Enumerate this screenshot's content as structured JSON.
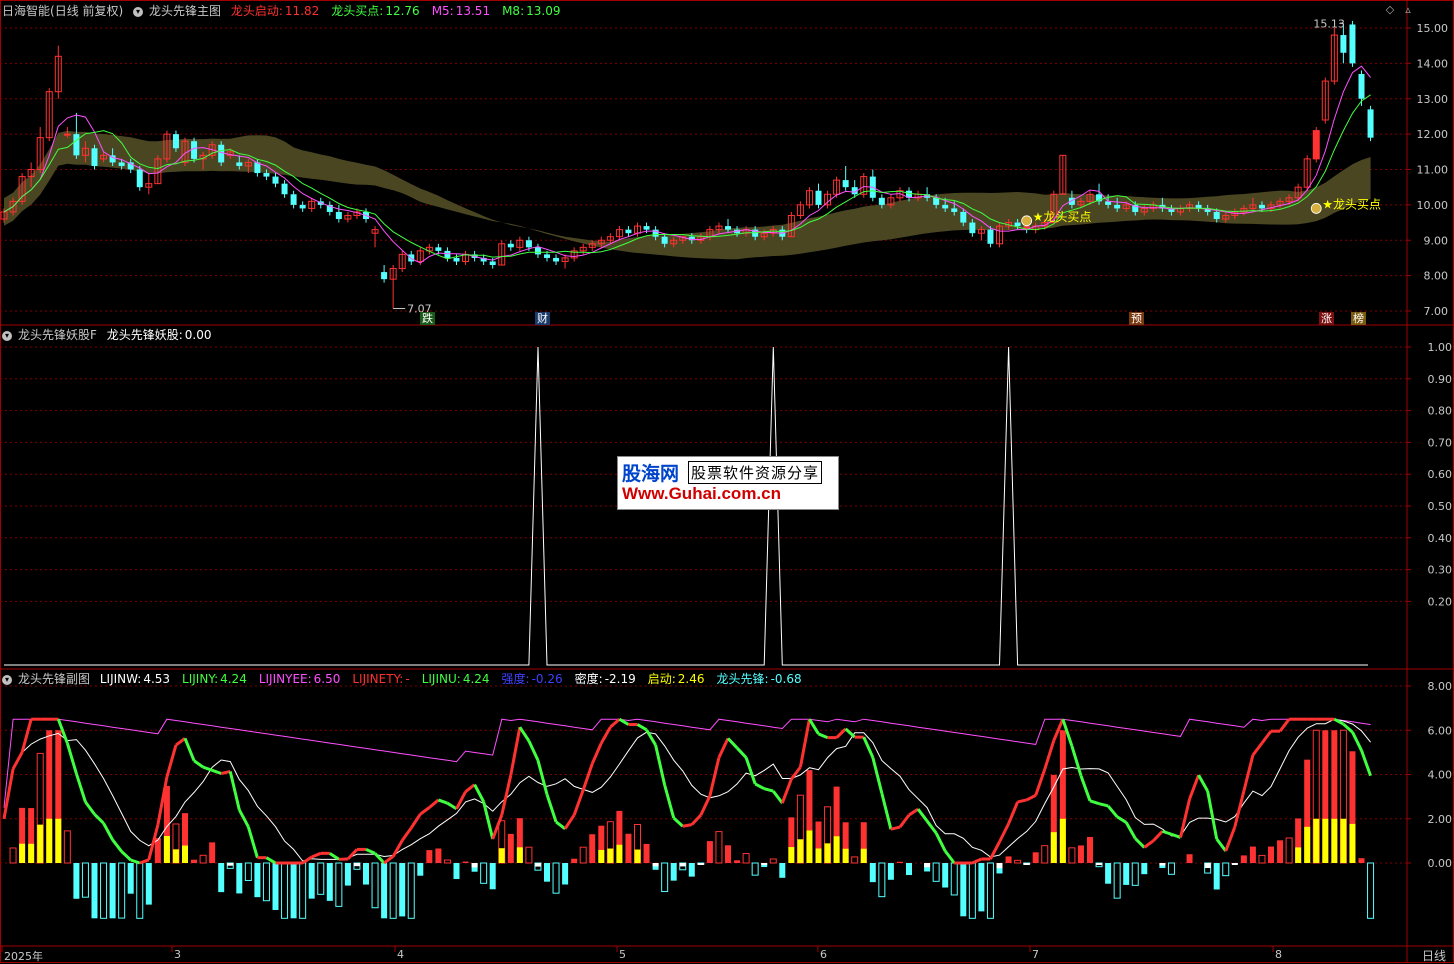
{
  "colors": {
    "up": "#ff3232",
    "down": "#54ffff",
    "ma5": "#ff50ff",
    "ma8": "#40ff40",
    "band": "#4a4622",
    "grid": "#800000",
    "border": "#a00000",
    "yellow": "#ffff00"
  },
  "main_panel": {
    "app_name": "日海智能",
    "period": "(日线 前复权)",
    "indicator_name": "龙头先锋主图",
    "legend": [
      {
        "label": "龙头启动:",
        "value": "11.82",
        "color": "#ff3030"
      },
      {
        "label": "龙头买点:",
        "value": "12.76",
        "color": "#40ff40"
      },
      {
        "label": "M5:",
        "value": "13.51",
        "color": "#ff50ff"
      },
      {
        "label": "M8:",
        "value": "13.09",
        "color": "#40ff40"
      }
    ],
    "y_ticks": [
      "15.00",
      "14.00",
      "13.00",
      "12.00",
      "11.00",
      "10.00",
      "9.00",
      "8.00",
      "7.00"
    ],
    "high_label": "15.13",
    "low_label": "7.07",
    "buy_point_label": "★龙头买点",
    "markers": [
      {
        "text": "跌",
        "bg": "#1a5a1a",
        "color": "#ffffff"
      },
      {
        "text": "财",
        "bg": "#1a3a6a",
        "color": "#ffffff"
      },
      {
        "text": "预",
        "bg": "#7a3a10",
        "color": "#ffffff"
      },
      {
        "text": "涨",
        "bg": "#7a1010",
        "color": "#ffffff"
      },
      {
        "text": "榜",
        "bg": "#7a5a10",
        "color": "#ffffff"
      }
    ]
  },
  "mid_panel": {
    "indicator_name": "龙头先锋妖股F",
    "legend": [
      {
        "label": "龙头先锋妖股:",
        "value": "0.00",
        "color": "#ffffff"
      }
    ],
    "y_ticks": [
      "1.00",
      "0.90",
      "0.80",
      "0.70",
      "0.60",
      "0.50",
      "0.40",
      "0.30",
      "0.20"
    ]
  },
  "bottom_panel": {
    "indicator_name": "龙头先锋副图",
    "legend": [
      {
        "label": "LIJINW:",
        "value": "4.53",
        "color": "#ffffff"
      },
      {
        "label": "LIJINY:",
        "value": "4.24",
        "color": "#40ff40"
      },
      {
        "label": "LIJINYEE:",
        "value": "6.50",
        "color": "#ff50ff"
      },
      {
        "label": "LIJINETY:",
        "value": "-",
        "color": "#ff3030"
      },
      {
        "label": "LIJINU:",
        "value": "4.24",
        "color": "#40ff40"
      },
      {
        "label": "强度:",
        "value": "-0.26",
        "color": "#4040ff"
      },
      {
        "label": "密度:",
        "value": "-2.19",
        "color": "#ffffff"
      },
      {
        "label": "启动:",
        "value": "2.46",
        "color": "#ffff00"
      },
      {
        "label": "龙头先锋:",
        "value": "-0.68",
        "color": "#54ffff"
      }
    ],
    "y_ticks": [
      "8.00",
      "6.00",
      "4.00",
      "2.00",
      "0.00"
    ]
  },
  "time_axis": {
    "labels": [
      "2025年",
      "3",
      "4",
      "5",
      "6",
      "7",
      "8"
    ],
    "period_button": "日线"
  },
  "watermark": {
    "logo": "股海网",
    "slogan": "股票软件资源分享",
    "url": "Www.Guhai.com.cn"
  },
  "chart_data": [
    {
      "type": "candlestick",
      "title": "龙头先锋主图",
      "ylim": [
        6.7,
        15.4
      ],
      "candles": [
        [
          9.6,
          9.9,
          9.5,
          9.8
        ],
        [
          9.8,
          10.2,
          9.7,
          10.1
        ],
        [
          10.1,
          10.9,
          10.0,
          10.8
        ],
        [
          10.8,
          11.2,
          10.5,
          11.0
        ],
        [
          11.0,
          12.2,
          10.9,
          11.9
        ],
        [
          11.9,
          13.3,
          11.8,
          13.2
        ],
        [
          13.2,
          14.5,
          13.0,
          14.2
        ],
        [
          12.0,
          12.2,
          11.9,
          12.0
        ],
        [
          12.0,
          12.6,
          11.3,
          11.4
        ],
        [
          11.4,
          11.8,
          11.2,
          11.6
        ],
        [
          11.6,
          11.7,
          11.0,
          11.1
        ],
        [
          11.3,
          11.5,
          11.2,
          11.4
        ],
        [
          11.4,
          11.6,
          11.1,
          11.2
        ],
        [
          11.2,
          11.3,
          11.0,
          11.1
        ],
        [
          11.2,
          11.3,
          10.9,
          11.0
        ],
        [
          11.0,
          11.1,
          10.4,
          10.5
        ],
        [
          10.5,
          10.9,
          10.3,
          10.6
        ],
        [
          10.6,
          11.4,
          10.6,
          11.3
        ],
        [
          11.3,
          12.1,
          11.2,
          12.0
        ],
        [
          12.0,
          12.1,
          11.5,
          11.6
        ],
        [
          11.2,
          11.9,
          11.1,
          11.8
        ],
        [
          11.8,
          11.9,
          11.2,
          11.3
        ],
        [
          11.3,
          11.5,
          11.0,
          11.4
        ],
        [
          11.4,
          11.8,
          11.3,
          11.7
        ],
        [
          11.7,
          11.8,
          11.1,
          11.2
        ],
        [
          11.4,
          11.6,
          11.3,
          11.5
        ],
        [
          11.2,
          11.4,
          11.0,
          11.1
        ],
        [
          11.1,
          11.3,
          10.9,
          11.2
        ],
        [
          11.2,
          11.3,
          10.8,
          10.9
        ],
        [
          10.9,
          11.0,
          10.7,
          10.8
        ],
        [
          10.8,
          10.9,
          10.5,
          10.6
        ],
        [
          10.6,
          10.7,
          10.2,
          10.3
        ],
        [
          10.3,
          10.4,
          9.9,
          10.0
        ],
        [
          10.0,
          10.1,
          9.8,
          9.9
        ],
        [
          9.9,
          10.2,
          9.8,
          10.1
        ],
        [
          10.1,
          10.2,
          9.9,
          10.0
        ],
        [
          10.0,
          10.1,
          9.7,
          9.8
        ],
        [
          9.8,
          10.0,
          9.5,
          9.6
        ],
        [
          9.6,
          9.8,
          9.5,
          9.7
        ],
        [
          9.7,
          9.9,
          9.6,
          9.8
        ],
        [
          9.8,
          9.9,
          9.5,
          9.6
        ],
        [
          9.2,
          9.4,
          8.8,
          9.3
        ],
        [
          8.1,
          8.3,
          7.8,
          7.9
        ],
        [
          7.9,
          8.3,
          7.07,
          8.2
        ],
        [
          8.2,
          8.7,
          8.1,
          8.6
        ],
        [
          8.6,
          8.7,
          8.3,
          8.4
        ],
        [
          8.4,
          8.8,
          8.3,
          8.7
        ],
        [
          8.7,
          8.9,
          8.6,
          8.8
        ],
        [
          8.8,
          8.9,
          8.6,
          8.7
        ],
        [
          8.7,
          8.8,
          8.4,
          8.5
        ],
        [
          8.5,
          8.6,
          8.3,
          8.4
        ],
        [
          8.4,
          8.7,
          8.3,
          8.6
        ],
        [
          8.6,
          8.7,
          8.4,
          8.5
        ],
        [
          8.5,
          8.6,
          8.3,
          8.4
        ],
        [
          8.4,
          8.5,
          8.2,
          8.3
        ],
        [
          8.3,
          9.0,
          8.3,
          8.9
        ],
        [
          8.9,
          9.0,
          8.7,
          8.8
        ],
        [
          8.8,
          9.1,
          8.7,
          9.0
        ],
        [
          9.0,
          9.1,
          8.7,
          8.8
        ],
        [
          8.8,
          8.9,
          8.5,
          8.6
        ],
        [
          8.6,
          8.7,
          8.4,
          8.5
        ],
        [
          8.5,
          8.6,
          8.3,
          8.4
        ],
        [
          8.4,
          8.6,
          8.2,
          8.5
        ],
        [
          8.5,
          8.8,
          8.4,
          8.7
        ],
        [
          8.7,
          8.9,
          8.6,
          8.8
        ],
        [
          8.8,
          9.0,
          8.7,
          8.9
        ],
        [
          8.9,
          9.1,
          8.8,
          9.0
        ],
        [
          9.0,
          9.2,
          8.9,
          9.1
        ],
        [
          9.1,
          9.4,
          9.0,
          9.3
        ],
        [
          9.3,
          9.4,
          9.1,
          9.2
        ],
        [
          9.2,
          9.5,
          9.1,
          9.4
        ],
        [
          9.4,
          9.5,
          9.2,
          9.3
        ],
        [
          9.3,
          9.4,
          9.0,
          9.1
        ],
        [
          9.1,
          9.2,
          8.8,
          8.9
        ],
        [
          8.9,
          9.1,
          8.8,
          9.0
        ],
        [
          9.0,
          9.1,
          8.9,
          9.1
        ],
        [
          9.1,
          9.2,
          8.9,
          9.0
        ],
        [
          9.0,
          9.2,
          8.9,
          9.1
        ],
        [
          9.1,
          9.4,
          9.0,
          9.3
        ],
        [
          9.3,
          9.5,
          9.2,
          9.4
        ],
        [
          9.4,
          9.6,
          9.2,
          9.3
        ],
        [
          9.3,
          9.4,
          9.1,
          9.2
        ],
        [
          9.2,
          9.4,
          9.1,
          9.3
        ],
        [
          9.3,
          9.4,
          9.0,
          9.1
        ],
        [
          9.1,
          9.3,
          9.0,
          9.2
        ],
        [
          9.2,
          9.4,
          9.1,
          9.3
        ],
        [
          9.3,
          9.4,
          9.0,
          9.1
        ],
        [
          9.1,
          9.8,
          9.1,
          9.7
        ],
        [
          9.7,
          10.1,
          9.6,
          10.0
        ],
        [
          10.0,
          10.5,
          9.9,
          10.4
        ],
        [
          10.4,
          10.6,
          9.9,
          10.0
        ],
        [
          10.0,
          10.4,
          9.9,
          10.3
        ],
        [
          10.3,
          10.8,
          10.2,
          10.7
        ],
        [
          10.7,
          11.1,
          10.4,
          10.5
        ],
        [
          10.5,
          10.7,
          10.2,
          10.3
        ],
        [
          10.3,
          10.9,
          10.2,
          10.8
        ],
        [
          10.8,
          11.0,
          10.1,
          10.2
        ],
        [
          10.2,
          10.3,
          9.9,
          10.0
        ],
        [
          10.0,
          10.3,
          9.9,
          10.2
        ],
        [
          10.2,
          10.5,
          10.1,
          10.4
        ],
        [
          10.4,
          10.5,
          10.1,
          10.2
        ],
        [
          10.2,
          10.4,
          10.1,
          10.3
        ],
        [
          10.3,
          10.5,
          10.1,
          10.2
        ],
        [
          10.2,
          10.3,
          9.9,
          10.0
        ],
        [
          10.0,
          10.2,
          9.8,
          9.9
        ],
        [
          9.9,
          10.1,
          9.7,
          9.8
        ],
        [
          9.8,
          9.9,
          9.4,
          9.5
        ],
        [
          9.5,
          9.6,
          9.1,
          9.2
        ],
        [
          9.2,
          9.4,
          9.0,
          9.3
        ],
        [
          9.3,
          9.4,
          8.8,
          8.9
        ],
        [
          8.9,
          9.5,
          8.8,
          9.4
        ],
        [
          9.4,
          9.6,
          9.3,
          9.5
        ],
        [
          9.5,
          9.6,
          9.3,
          9.4
        ],
        [
          9.4,
          9.5,
          9.2,
          9.3
        ],
        [
          9.3,
          9.5,
          9.2,
          9.4
        ],
        [
          9.4,
          9.6,
          9.3,
          9.5
        ],
        [
          9.5,
          10.4,
          9.5,
          10.3
        ],
        [
          10.3,
          11.4,
          10.3,
          11.4
        ],
        [
          10.2,
          10.4,
          9.9,
          10.0
        ],
        [
          10.0,
          10.2,
          9.9,
          10.1
        ],
        [
          10.1,
          10.4,
          10.0,
          10.3
        ],
        [
          10.3,
          10.6,
          10.0,
          10.1
        ],
        [
          10.1,
          10.3,
          9.9,
          10.0
        ],
        [
          10.0,
          10.2,
          9.8,
          9.9
        ],
        [
          9.9,
          10.1,
          9.8,
          10.0
        ],
        [
          10.0,
          10.1,
          9.7,
          9.8
        ],
        [
          9.8,
          10.0,
          9.7,
          9.9
        ],
        [
          9.9,
          10.1,
          9.8,
          10.0
        ],
        [
          10.0,
          10.2,
          9.8,
          9.9
        ],
        [
          9.9,
          10.0,
          9.7,
          9.8
        ],
        [
          9.8,
          10.0,
          9.7,
          9.9
        ],
        [
          9.9,
          10.1,
          9.8,
          10.0
        ],
        [
          10.0,
          10.1,
          9.8,
          9.9
        ],
        [
          9.9,
          10.0,
          9.7,
          9.8
        ],
        [
          9.8,
          9.9,
          9.5,
          9.6
        ],
        [
          9.6,
          9.8,
          9.5,
          9.7
        ],
        [
          9.7,
          9.9,
          9.6,
          9.8
        ],
        [
          9.8,
          10.0,
          9.7,
          9.9
        ],
        [
          9.9,
          10.2,
          9.8,
          10.0
        ],
        [
          10.0,
          10.1,
          9.8,
          9.9
        ],
        [
          9.9,
          10.1,
          9.8,
          10.0
        ],
        [
          10.0,
          10.2,
          9.9,
          10.1
        ],
        [
          10.1,
          10.3,
          10.0,
          10.2
        ],
        [
          10.2,
          10.6,
          10.1,
          10.5
        ],
        [
          10.5,
          11.4,
          10.4,
          11.3
        ],
        [
          11.3,
          12.2,
          11.2,
          12.1
        ],
        [
          12.4,
          13.6,
          12.3,
          13.5
        ],
        [
          13.5,
          15.0,
          13.4,
          14.8
        ],
        [
          14.8,
          15.13,
          14.0,
          14.3
        ],
        [
          15.1,
          15.2,
          13.9,
          14.0
        ],
        [
          13.7,
          13.8,
          12.8,
          13.0
        ],
        [
          12.7,
          12.8,
          11.8,
          11.9
        ]
      ]
    }
  ]
}
